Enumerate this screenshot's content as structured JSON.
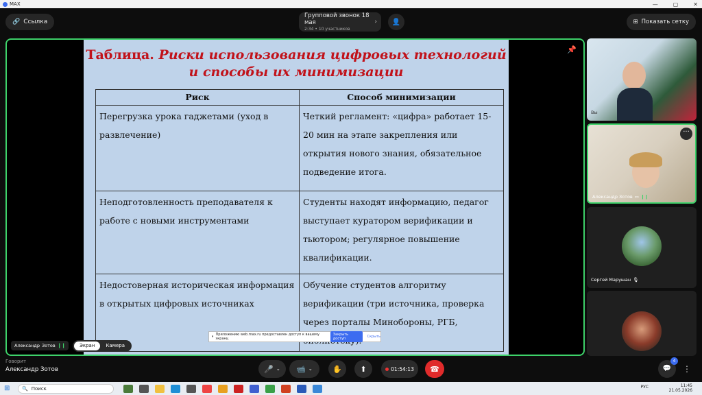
{
  "window": {
    "app_name": "MAX",
    "controls": [
      "—",
      "▢",
      "✕"
    ]
  },
  "topbar": {
    "link_label": "Ссылка",
    "call_title": "Групповой звонок 18 мая",
    "call_sub": "2:34  •  10 участников",
    "grid_label": "Показать сетку"
  },
  "slide": {
    "title_plain": "Таблица. ",
    "title_italic": "Риски использования цифровых технологий и способы их минимизации",
    "headers": [
      "Риск",
      "Способ минимизации"
    ],
    "rows": [
      [
        "Перегрузка урока гаджетами (уход в развлечение)",
        "Четкий регламент: «цифра» работает 15-20 мин на этапе закрепления или открытия нового знания, обязательное подведение итога."
      ],
      [
        "Неподготовленность преподавателя к работе с новыми инструментами",
        "Студенты находят информацию, педагог выступает куратором верификации и тьютором; регулярное повышение квалификации."
      ],
      [
        "Недостоверная историческая информация в открытых цифровых источниках",
        "Обучение студентов алгоритму верификации (три источника, проверка через порталы Минобороны, РГБ, библиотеку)."
      ]
    ]
  },
  "stage": {
    "speaker_first": "Александр",
    "speaker_last": "Зотов",
    "view_screen": "Экран",
    "view_camera": "Камера",
    "notice_text": "Приложению web.max.ru предоставлен доступ к вашему экрану.",
    "notice_share": "Закрыть доступ",
    "notice_hide": "Скрыть"
  },
  "participants": [
    {
      "label": "Вы"
    },
    {
      "label": "Александр    Зотов"
    },
    {
      "label": "Сергей Марушан"
    },
    {
      "label": ""
    }
  ],
  "bottombar": {
    "speaking_label": "Говорит",
    "speaking_name": "Александр    Зотов",
    "timer": "01:54:13",
    "chat_badge": "4"
  },
  "taskbar": {
    "search_placeholder": "Поиск",
    "lang": "РУС",
    "time": "11:45",
    "date": "21.05.2026"
  },
  "colors": {
    "accent_green": "#3ed26a",
    "hangup_red": "#e02b2b",
    "slide_bg": "#bfd3ea",
    "title_red": "#c1121a"
  }
}
